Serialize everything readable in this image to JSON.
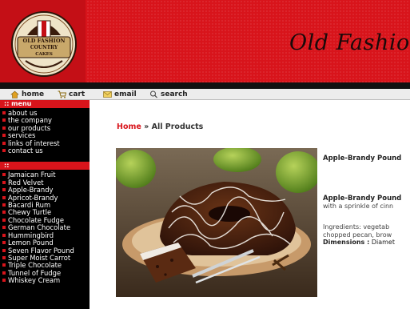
{
  "header": {
    "title": "Old Fashion",
    "logo_lines": [
      "OLD FASHION",
      "COUNTRY",
      "CAKES"
    ]
  },
  "toolbar": {
    "items": [
      {
        "label": "home",
        "icon": "home-icon"
      },
      {
        "label": "cart",
        "icon": "cart-icon"
      },
      {
        "label": "email",
        "icon": "email-icon"
      },
      {
        "label": "search",
        "icon": "search-icon"
      }
    ]
  },
  "sidebar": {
    "menu_heading": ":: menu",
    "menu_items": [
      "about us",
      "the company",
      "our products",
      "services",
      "links of interest",
      "contact us"
    ],
    "products_heading": "::",
    "product_items": [
      "Jamaican Fruit",
      "Red Velvet",
      "Apple-Brandy",
      "Apricot-Brandy",
      "Bacardi Rum",
      "Chewy Turtle",
      "Chocolate Fudge",
      "German Chocolate",
      "Hummingbird",
      "Lemon Pound",
      "Seven Flavor Pound",
      "Super Moist Carrot",
      "Triple Chocolate",
      "Tunnel of Fudge",
      "Whiskey Cream"
    ]
  },
  "main": {
    "breadcrumb_home": "Home",
    "breadcrumb_sep": "»",
    "breadcrumb_current": "All Products",
    "product_title": "Apple-Brandy Pound",
    "desc_title": "Apple-Brandy Pound",
    "desc_text": "with a sprinkle of cinn",
    "ingredients_line1": "Ingredients: vegetab",
    "ingredients_line2": "chopped pecan, brow",
    "dimensions_label": "Dimensions :",
    "dimensions_value": "Diamet"
  },
  "colors": {
    "brand_red": "#d8141b",
    "sidebar_bg": "#000000",
    "toolbar_bg": "#ececec"
  }
}
